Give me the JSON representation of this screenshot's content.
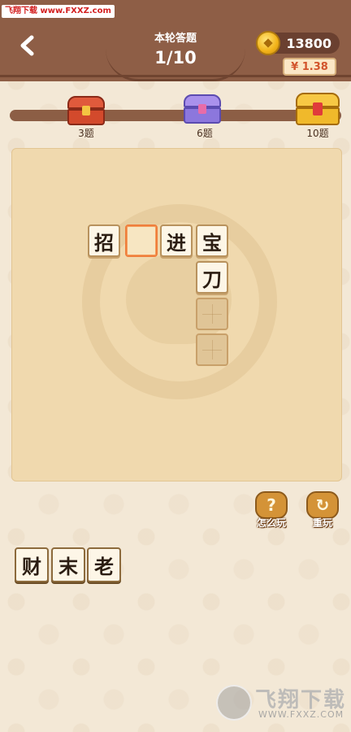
{
  "watermark": "飞翔下载 www.FXXZ.com",
  "header": {
    "round_label": "本轮答题",
    "progress": "1/10",
    "coins": "13800",
    "money": "¥ 1.38"
  },
  "milestones": [
    {
      "label": "3题",
      "color": "#d34a2c"
    },
    {
      "label": "6题",
      "color": "#8c77dd"
    },
    {
      "label": "10题",
      "color": "#f0b92b"
    }
  ],
  "board": {
    "cells": [
      {
        "char": "招",
        "state": "filled"
      },
      {
        "char": "",
        "state": "active"
      },
      {
        "char": "进",
        "state": "filled"
      },
      {
        "char": "宝",
        "state": "filled"
      },
      {
        "char": "刀",
        "state": "filled"
      },
      {
        "char": "",
        "state": "empty"
      },
      {
        "char": "",
        "state": "empty"
      }
    ]
  },
  "tools": {
    "howto_label": "怎么玩",
    "replay_label": "重玩"
  },
  "options": [
    "财",
    "末",
    "老"
  ],
  "footer": {
    "logo_text": "飞翔下载",
    "logo_url": "WWW.FXXZ.COM"
  }
}
